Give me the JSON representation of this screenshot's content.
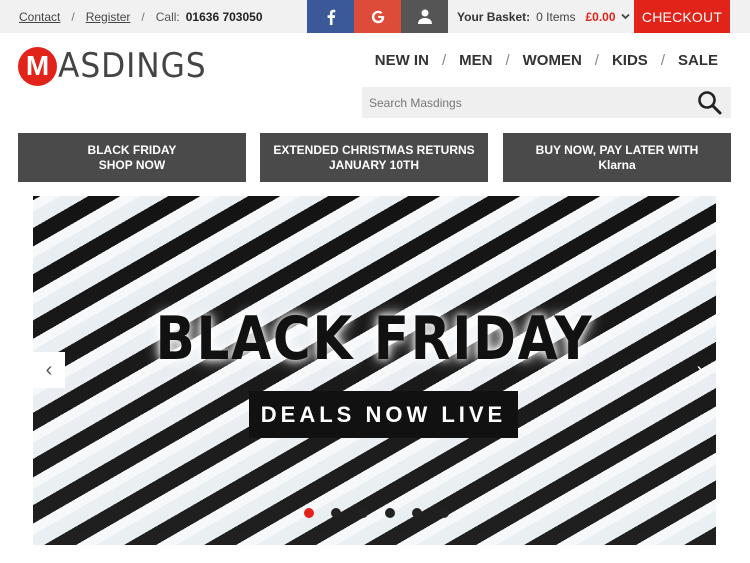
{
  "topbar": {
    "contact": "Contact",
    "register": "Register",
    "call_label": "Call:",
    "phone": "01636 703050",
    "separator": "/"
  },
  "social": {
    "facebook_icon": "facebook-icon",
    "google_icon": "google-icon",
    "account_icon": "user-icon"
  },
  "basket": {
    "label": "Your Basket:",
    "items": "0 Items",
    "total": "£0.00",
    "dropdown_icon": "chevron-down-icon"
  },
  "checkout": "CHECKOUT",
  "logo": {
    "letter": "M",
    "rest": "ASDINGS"
  },
  "nav": [
    "NEW IN",
    "MEN",
    "WOMEN",
    "KIDS",
    "SALE"
  ],
  "search": {
    "placeholder": "Search Masdings",
    "icon": "search-icon"
  },
  "promos": [
    {
      "line1": "BLACK FRIDAY",
      "line2": "SHOP NOW"
    },
    {
      "line1": "EXTENDED CHRISTMAS RETURNS",
      "line2": "JANUARY 10TH"
    },
    {
      "line1": "BUY NOW, PAY LATER WITH",
      "line2": "Klarna"
    }
  ],
  "hero": {
    "title": "BLACK FRIDAY",
    "subtitle": "DEALS NOW LIVE",
    "prev": "‹",
    "next": "›",
    "slide_count": 6,
    "active_slide": 1
  },
  "colors": {
    "brand_red": "#e2231a",
    "facebook": "#3b5998",
    "google": "#dd4b39",
    "promo_bg": "#4a4a4a"
  }
}
